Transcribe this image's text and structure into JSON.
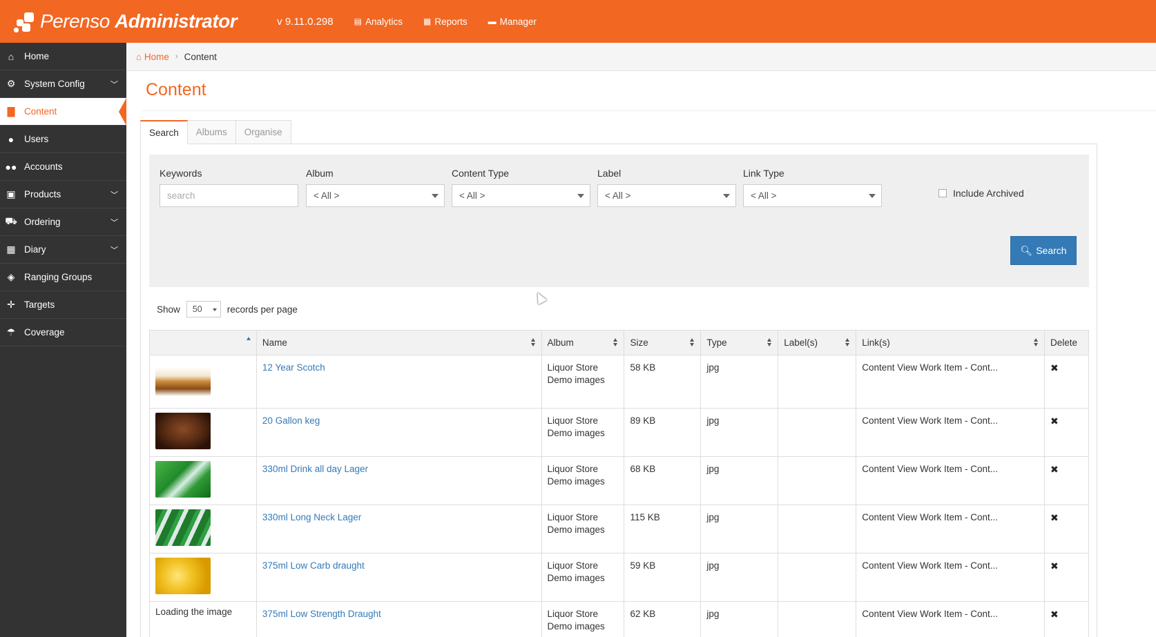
{
  "header": {
    "brand_light": "Perenso",
    "brand_bold": "Administrator",
    "version": "v 9.11.0.298",
    "nav": [
      {
        "label": "Analytics",
        "icon": "chart-icon"
      },
      {
        "label": "Reports",
        "icon": "table-icon"
      },
      {
        "label": "Manager",
        "icon": "briefcase-icon"
      }
    ]
  },
  "sidebar": {
    "items": [
      {
        "label": "Home",
        "icon": "home-icon",
        "glyph": "⌂",
        "chevron": false
      },
      {
        "label": "System Config",
        "icon": "gear-icon",
        "glyph": "⚙",
        "chevron": true
      },
      {
        "label": "Content",
        "icon": "file-icon",
        "glyph": "▇",
        "chevron": false,
        "active": true
      },
      {
        "label": "Users",
        "icon": "user-icon",
        "glyph": "●",
        "chevron": false
      },
      {
        "label": "Accounts",
        "icon": "users-icon",
        "glyph": "●●",
        "chevron": false
      },
      {
        "label": "Products",
        "icon": "gift-icon",
        "glyph": "▣",
        "chevron": true
      },
      {
        "label": "Ordering",
        "icon": "cart-icon",
        "glyph": "⛟",
        "chevron": true
      },
      {
        "label": "Diary",
        "icon": "calendar-icon",
        "glyph": "▦",
        "chevron": true
      },
      {
        "label": "Ranging Groups",
        "icon": "cubes-icon",
        "glyph": "◈",
        "chevron": false
      },
      {
        "label": "Targets",
        "icon": "crosshairs-icon",
        "glyph": "✛",
        "chevron": false
      },
      {
        "label": "Coverage",
        "icon": "umbrella-icon",
        "glyph": "☂",
        "chevron": false
      }
    ]
  },
  "breadcrumb": {
    "home": "Home",
    "current": "Content"
  },
  "page": {
    "title": "Content"
  },
  "tabs": [
    "Search",
    "Albums",
    "Organise"
  ],
  "filters": {
    "keywords_label": "Keywords",
    "keywords_placeholder": "search",
    "album_label": "Album",
    "album_value": "< All >",
    "content_type_label": "Content Type",
    "content_type_value": "< All >",
    "label_label": "Label",
    "label_value": "< All >",
    "link_type_label": "Link Type",
    "link_type_value": "< All >",
    "include_archived": "Include Archived",
    "search_button": "Search"
  },
  "paging": {
    "show": "Show",
    "per_page_value": "50",
    "records_per_page": "records per page"
  },
  "table": {
    "headers": [
      "",
      "Name",
      "Album",
      "Size",
      "Type",
      "Label(s)",
      "Link(s)",
      "Delete"
    ],
    "rows": [
      {
        "thumb": "scotch",
        "name": "12 Year Scotch",
        "album1": "Liquor Store",
        "album2": "Demo images",
        "size": "58 KB",
        "type": "jpg",
        "labels": "",
        "links": "Content View Work Item - Cont..."
      },
      {
        "thumb": "keg",
        "name": "20 Gallon keg",
        "album1": "Liquor Store",
        "album2": "Demo images",
        "size": "89 KB",
        "type": "jpg",
        "labels": "",
        "links": "Content View Work Item - Cont..."
      },
      {
        "thumb": "lager-green",
        "name": "330ml Drink all day Lager",
        "album1": "Liquor Store",
        "album2": "Demo images",
        "size": "68 KB",
        "type": "jpg",
        "labels": "",
        "links": "Content View Work Item - Cont..."
      },
      {
        "thumb": "bottles-ice",
        "name": "330ml Long Neck Lager",
        "album1": "Liquor Store",
        "album2": "Demo images",
        "size": "115 KB",
        "type": "jpg",
        "labels": "",
        "links": "Content View Work Item - Cont..."
      },
      {
        "thumb": "beer-yellow",
        "name": "375ml Low Carb draught",
        "album1": "Liquor Store",
        "album2": "Demo images",
        "size": "59 KB",
        "type": "jpg",
        "labels": "",
        "links": "Content View Work Item - Cont..."
      },
      {
        "thumb": "",
        "thumb_text": "Loading the image",
        "name": "375ml Low Strength Draught",
        "album1": "Liquor Store",
        "album2": "Demo images",
        "size": "62 KB",
        "type": "jpg",
        "labels": "",
        "links": "Content View Work Item - Cont..."
      }
    ]
  },
  "colors": {
    "brand": "#f26722",
    "sidebar": "#333333",
    "link": "#337ab7",
    "button": "#337ab7"
  }
}
